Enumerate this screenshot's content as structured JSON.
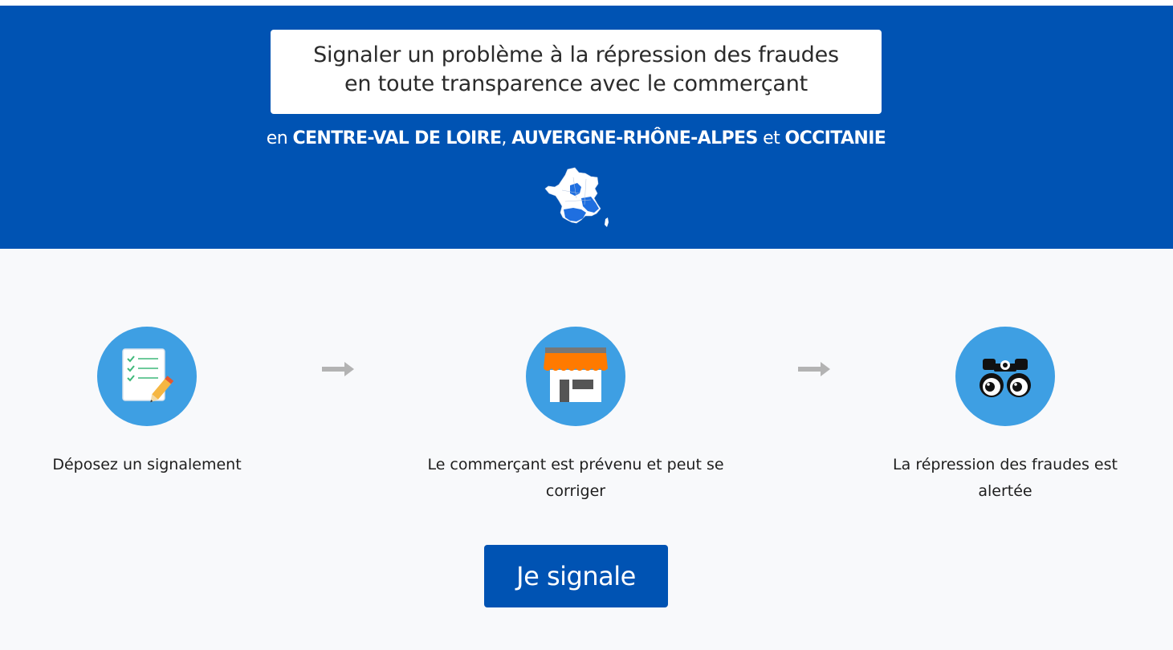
{
  "hero": {
    "title_line1": "Signaler un problème à la répression des fraudes",
    "title_line2": "en toute transparence avec le commerçant",
    "regions_prefix": "en ",
    "region1": "CENTRE-VAL DE LOIRE",
    "separator": ", ",
    "region2": "AUVERGNE-RHÔNE-ALPES",
    "conjunction": " et ",
    "region3": "OCCITANIE",
    "map_icon": "france-map-icon"
  },
  "steps": [
    {
      "icon": "checklist-pencil-icon",
      "label": "Déposez un signalement"
    },
    {
      "icon": "shop-icon",
      "label": "Le commerçant est prévenu et peut se corriger"
    },
    {
      "icon": "binoculars-icon",
      "label": "La répression des fraudes est alertée"
    }
  ],
  "cta": {
    "label": "Je signale"
  },
  "colors": {
    "brand_blue": "#0053b3",
    "icon_circle": "#3e9fe3",
    "background": "#f8f9fb",
    "arrow_gray": "#b3b3b3",
    "awning_orange": "#ff7a00"
  }
}
